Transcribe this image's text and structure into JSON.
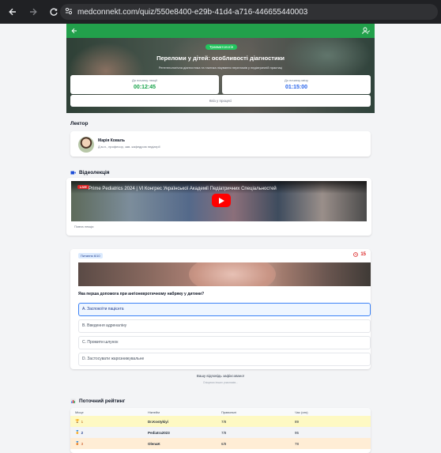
{
  "browser": {
    "url": "medconnekt.com/quiz/550e8400-e29b-41d4-a716-446655440003"
  },
  "hero": {
    "category": "Травматологія",
    "title": "Переломи у дітей: особливості діагностики",
    "subtitle": "Рентгенологічна діагностика та тактика лікування переломів у педіатричній практиці",
    "lecture_timer_label": "До початку лекції",
    "lecture_timer_value": "00:12:45",
    "quiz_timer_label": "До початку квізу",
    "quiz_timer_value": "01:15:00",
    "status": "Квіз у процесі"
  },
  "lecturer": {
    "section_title": "Лектор",
    "name": "Марія Коваль",
    "description": "Д.м.н., професор, зав. кафедрою педіатрії"
  },
  "video": {
    "section_title": "Відеолекція",
    "live_badge": "LIVE",
    "title": "Prime Pediatrics 2024 | VI Конгрес Української Академії Педіатричних Спеціальностей",
    "caption": "Повна лекція"
  },
  "quiz": {
    "badge": "Питання 6/10",
    "timer": "15",
    "question": "Яка перша допомога при ангіоневротичному набряку у дитини?",
    "options": [
      {
        "label": "A. Заспокоїти пацієнта",
        "selected": true
      },
      {
        "label": "B. Введення адреналіну",
        "selected": false
      },
      {
        "label": "C. Промити шлунок",
        "selected": false
      },
      {
        "label": "D. Застосувати жарознижувальне",
        "selected": false
      }
    ],
    "submitted_note": "Вашу відповідь зафіксовано!",
    "waiting_note": "Очікуємо інших учасників..."
  },
  "rating": {
    "section_title": "Поточний рейтинг",
    "columns": [
      "Місце",
      "Нікнейм",
      "Правильні",
      "Час (сек)"
    ],
    "rows": [
      {
        "place": "1",
        "nickname": "Dr.Kostykiyi",
        "correct": "7/8",
        "time": "89"
      },
      {
        "place": "2",
        "nickname": "Pediatra2023",
        "correct": "7/8",
        "time": "95"
      },
      {
        "place": "3",
        "nickname": "OlenaK",
        "correct": "6/8",
        "time": "78"
      }
    ]
  },
  "colors": {
    "green": "#22a04b",
    "blue": "#2563eb",
    "red": "#dc2626",
    "gold": "#fef9c3",
    "silver": "#f3f4f6",
    "bronze": "#ffedd5"
  }
}
